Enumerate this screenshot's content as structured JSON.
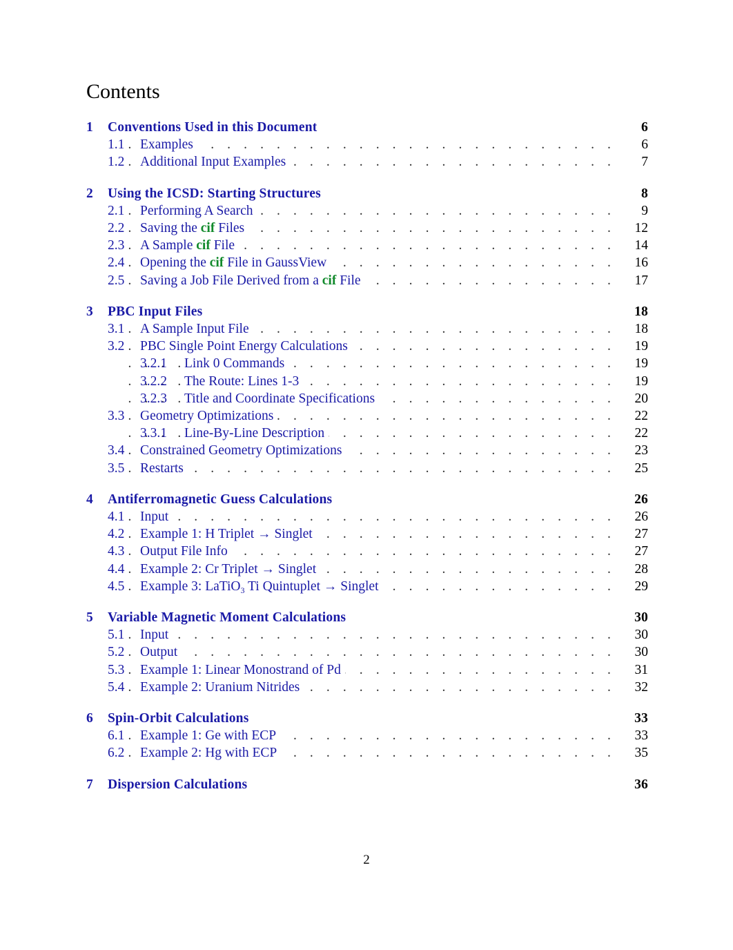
{
  "document": {
    "heading": "Contents",
    "footer_page_number": "2",
    "colors": {
      "link": "#1a1aa6",
      "cif_keyword": "#128a2c",
      "page_number": "#000000"
    }
  },
  "toc": [
    {
      "level": 1,
      "number": "1",
      "title": [
        {
          "t": "Conventions Used in this Document"
        }
      ],
      "page": "6"
    },
    {
      "level": 2,
      "number": "1.1",
      "title": [
        {
          "t": "Examples"
        }
      ],
      "page": "6"
    },
    {
      "level": 2,
      "number": "1.2",
      "title": [
        {
          "t": "Additional Input Examples"
        }
      ],
      "page": "7"
    },
    {
      "level": 1,
      "number": "2",
      "title": [
        {
          "t": "Using the ICSD: Starting Structures"
        }
      ],
      "page": "8"
    },
    {
      "level": 2,
      "number": "2.1",
      "title": [
        {
          "t": "Performing A Search"
        }
      ],
      "page": "9"
    },
    {
      "level": 2,
      "number": "2.2",
      "title": [
        {
          "t": "Saving the "
        },
        {
          "t": "cif",
          "style": "cif"
        },
        {
          "t": " Files"
        }
      ],
      "page": "12"
    },
    {
      "level": 2,
      "number": "2.3",
      "title": [
        {
          "t": "A Sample "
        },
        {
          "t": "cif",
          "style": "cif"
        },
        {
          "t": " File"
        }
      ],
      "page": "14"
    },
    {
      "level": 2,
      "number": "2.4",
      "title": [
        {
          "t": "Opening the "
        },
        {
          "t": "cif",
          "style": "cif"
        },
        {
          "t": " File in GaussView"
        }
      ],
      "page": "16"
    },
    {
      "level": 2,
      "number": "2.5",
      "title": [
        {
          "t": "Saving a Job File Derived from a "
        },
        {
          "t": "cif",
          "style": "cif"
        },
        {
          "t": " File"
        }
      ],
      "page": "17"
    },
    {
      "level": 1,
      "number": "3",
      "title": [
        {
          "t": "PBC Input Files"
        }
      ],
      "page": "18"
    },
    {
      "level": 2,
      "number": "3.1",
      "title": [
        {
          "t": "A Sample Input File"
        }
      ],
      "page": "18"
    },
    {
      "level": 2,
      "number": "3.2",
      "title": [
        {
          "t": "PBC Single Point Energy Calculations"
        }
      ],
      "page": "19"
    },
    {
      "level": 3,
      "number": "3.2.1",
      "title": [
        {
          "t": "Link 0 Commands"
        }
      ],
      "page": "19"
    },
    {
      "level": 3,
      "number": "3.2.2",
      "title": [
        {
          "t": "The Route: Lines 1-3"
        }
      ],
      "page": "19"
    },
    {
      "level": 3,
      "number": "3.2.3",
      "title": [
        {
          "t": "Title and Coordinate Specifications"
        }
      ],
      "page": "20"
    },
    {
      "level": 2,
      "number": "3.3",
      "title": [
        {
          "t": "Geometry Optimizations"
        }
      ],
      "page": "22"
    },
    {
      "level": 3,
      "number": "3.3.1",
      "title": [
        {
          "t": "Line-By-Line Description"
        }
      ],
      "page": "22"
    },
    {
      "level": 2,
      "number": "3.4",
      "title": [
        {
          "t": "Constrained Geometry Optimizations"
        }
      ],
      "page": "23"
    },
    {
      "level": 2,
      "number": "3.5",
      "title": [
        {
          "t": "Restarts"
        }
      ],
      "page": "25"
    },
    {
      "level": 1,
      "number": "4",
      "title": [
        {
          "t": "Antiferromagnetic Guess Calculations"
        }
      ],
      "page": "26"
    },
    {
      "level": 2,
      "number": "4.1",
      "title": [
        {
          "t": "Input"
        }
      ],
      "page": "26"
    },
    {
      "level": 2,
      "number": "4.2",
      "title": [
        {
          "t": "Example 1: H Triplet → Singlet"
        }
      ],
      "page": "27"
    },
    {
      "level": 2,
      "number": "4.3",
      "title": [
        {
          "t": "Output File Info"
        }
      ],
      "page": "27"
    },
    {
      "level": 2,
      "number": "4.4",
      "title": [
        {
          "t": "Example 2: Cr Triplet → Singlet"
        }
      ],
      "page": "28"
    },
    {
      "level": 2,
      "number": "4.5",
      "title": [
        {
          "t": "Example 3: LaTiO"
        },
        {
          "t": "3",
          "style": "sub"
        },
        {
          "t": " Ti Quintuplet → Singlet"
        }
      ],
      "page": "29"
    },
    {
      "level": 1,
      "number": "5",
      "title": [
        {
          "t": "Variable Magnetic Moment Calculations"
        }
      ],
      "page": "30"
    },
    {
      "level": 2,
      "number": "5.1",
      "title": [
        {
          "t": "Input"
        }
      ],
      "page": "30"
    },
    {
      "level": 2,
      "number": "5.2",
      "title": [
        {
          "t": "Output"
        }
      ],
      "page": "30"
    },
    {
      "level": 2,
      "number": "5.3",
      "title": [
        {
          "t": "Example 1: Linear Monostrand of Pd"
        }
      ],
      "page": "31"
    },
    {
      "level": 2,
      "number": "5.4",
      "title": [
        {
          "t": "Example 2: Uranium Nitrides"
        }
      ],
      "page": "32"
    },
    {
      "level": 1,
      "number": "6",
      "title": [
        {
          "t": "Spin-Orbit Calculations"
        }
      ],
      "page": "33"
    },
    {
      "level": 2,
      "number": "6.1",
      "title": [
        {
          "t": "Example 1: Ge with ECP"
        }
      ],
      "page": "33"
    },
    {
      "level": 2,
      "number": "6.2",
      "title": [
        {
          "t": "Example 2: Hg with ECP"
        }
      ],
      "page": "35"
    },
    {
      "level": 1,
      "number": "7",
      "title": [
        {
          "t": "Dispersion Calculations"
        }
      ],
      "page": "36"
    }
  ]
}
